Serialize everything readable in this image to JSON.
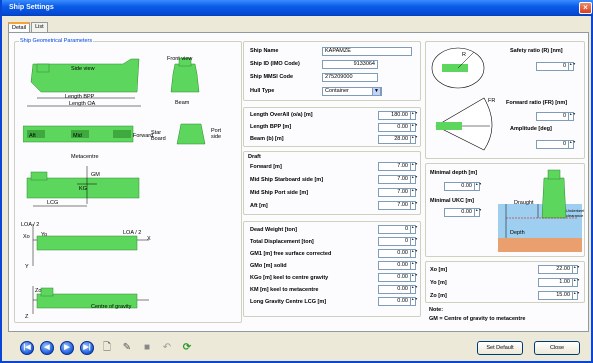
{
  "window": {
    "title": "Ship Settings",
    "close_label": "×"
  },
  "tabs": [
    {
      "label": "Detail"
    },
    {
      "label": "List"
    }
  ],
  "left_group": {
    "title": "Ship Geometrical Parameters",
    "side_view_label": "Side view",
    "front_view_label": "Front view",
    "length_bpp_label": "Length BPP",
    "length_oa_label": "Length OA",
    "beam_label": "Beam",
    "aft_label": "Aft",
    "mid_label": "Mid",
    "forward_label": "Forward",
    "starboard_label": "Star Board",
    "port_side_label": "Port side",
    "metacentre_label": "Metacentre",
    "gm_label": "GM",
    "kg_label": "KG",
    "lcg_label": "LCG",
    "loa2_left_label": "LOA / 2",
    "loa2_right_label": "LOA / 2",
    "centre_gravity_label": "Centre of gravity",
    "x_label": "X",
    "y_label": "Y",
    "z_label": "Z",
    "xo_label": "Xo",
    "zo_label": "Zo",
    "yo_label": "Yo"
  },
  "ship": {
    "name_label": "Ship Name",
    "name_value": "KAPAMZE",
    "imo_label": "Ship ID (IMO Code)",
    "imo_value": "9133064",
    "mmsi_label": "Ship MMSI Code",
    "mmsi_value": "275209000",
    "hull_label": "Hull Type",
    "hull_value": "Container"
  },
  "dimensions": {
    "loa_label": "Length OverAll (o/a) [m]",
    "loa_value": "180.00",
    "lbpp_label": "Length BPP [m]",
    "lbpp_value": "0.00",
    "beam_label": "Beam (b) [m]",
    "beam_value": "28.00"
  },
  "draft": {
    "title": "Draft",
    "forward_label": "Forward [m]",
    "forward_value": "7.00",
    "mid_star_label": "Mid Ship Starboard side [m]",
    "mid_star_value": "7.00",
    "mid_port_label": "Mid Ship Port side [m]",
    "mid_port_value": "7.00",
    "aft_label": "Aft [m]",
    "aft_value": "7.00"
  },
  "weights": [
    {
      "label": "Dead Weight [ton]",
      "value": "0"
    },
    {
      "label": "Total Displacement [ton]",
      "value": "0"
    },
    {
      "label": "GM1 [m] free surface corrected",
      "value": "0.00"
    },
    {
      "label": "GMo [m] solid",
      "value": "0.00"
    },
    {
      "label": "KGo [m] keel to centre gravity",
      "value": "0.00"
    },
    {
      "label": "KM [m] keel to metacentre",
      "value": "0.00"
    },
    {
      "label": "Long Gravity Centre LCG [m]",
      "value": "0.00"
    }
  ],
  "safety": {
    "safety_label": "Safety ratio (R) [nm]",
    "safety_value": "0",
    "forward_ratio_label": "Forward ratio (FR) [nm]",
    "forward_ratio_value": "0",
    "amplitude_label": "Amplitude [deg]",
    "amplitude_value": "0",
    "r_label": "R",
    "fr_label": "FR"
  },
  "depth": {
    "min_depth_label": "Minimal depth [m]",
    "min_depth_value": "0.00",
    "min_ukc_label": "Minimal UKC [m]",
    "min_ukc_value": "0.00",
    "draught_label": "Draught",
    "clearance_label": "Underkeel clearance",
    "depth_label": "Depth"
  },
  "coords": [
    {
      "label": "Xo [m]",
      "value": "22.00"
    },
    {
      "label": "Yo [m]",
      "value": "1.00"
    },
    {
      "label": "Zo [m]",
      "value": "15.00"
    }
  ],
  "note": {
    "title": "Note:",
    "text": "GM = Centre of gravity to metacentre"
  },
  "bottom": {
    "set_default_label": "Set Default",
    "close_label": "Close"
  },
  "colors": {
    "hull_green": "#5cd65c",
    "water": "#9ecff0",
    "sea_bed": "#e9a06e"
  }
}
